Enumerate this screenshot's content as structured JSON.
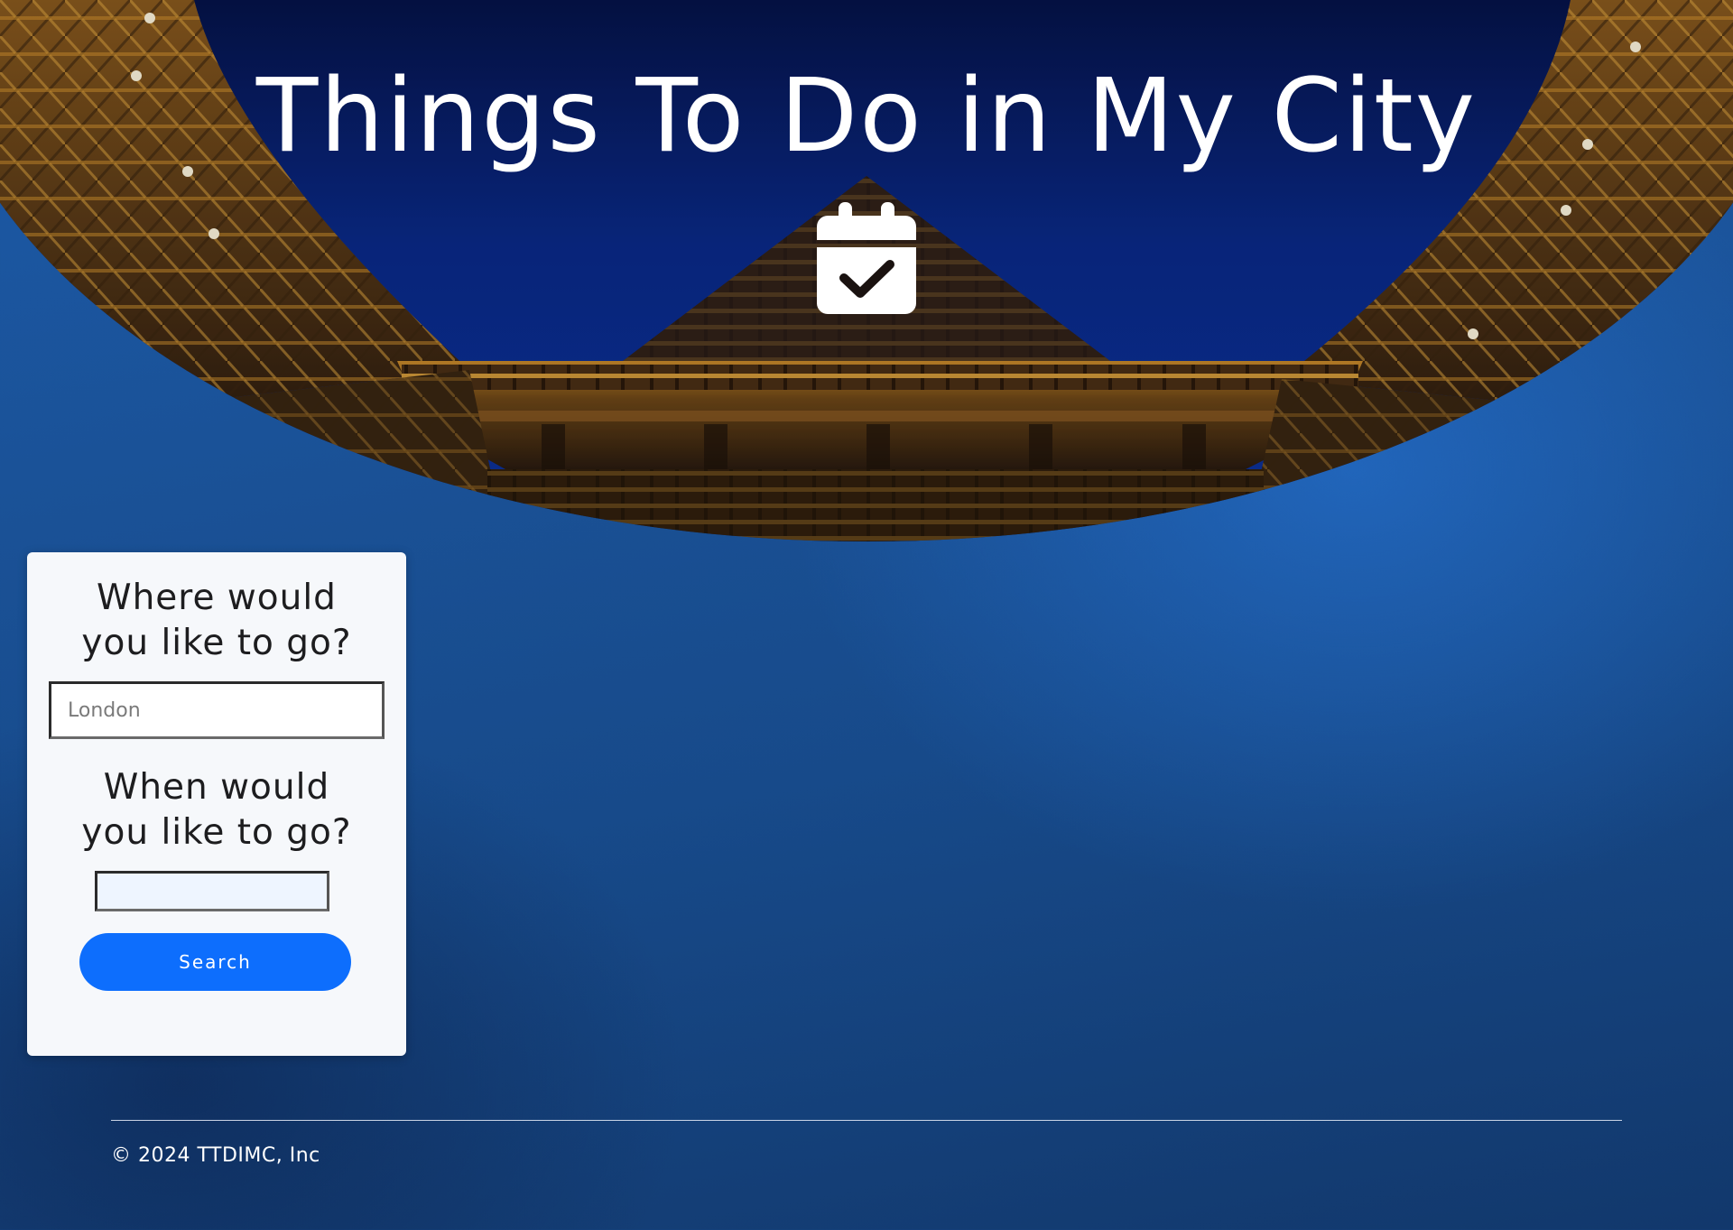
{
  "hero": {
    "title": "Things To Do in My City",
    "icon": "calendar-check-icon",
    "image": "globe-theatre-roof-at-night"
  },
  "search_form": {
    "where_heading": "Where would you like to go?",
    "where_placeholder": "London",
    "where_value": "",
    "when_heading": "When would you like to go?",
    "when_value": "",
    "search_button_label": "Search"
  },
  "footer": {
    "copyright": "© 2024 TTDIMC, Inc"
  },
  "colors": {
    "page_background": "#1a5196",
    "card_background": "#f6f8fb",
    "button_primary": "#0d6efd",
    "title_text": "#ffffff"
  }
}
